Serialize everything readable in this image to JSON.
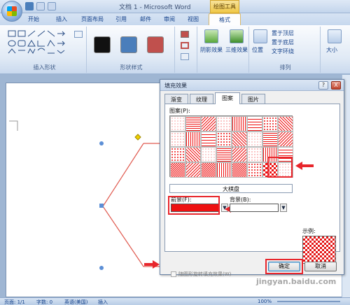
{
  "window": {
    "title": "文档 1 - Microsoft Word",
    "context_tools": "绘图工具"
  },
  "tabs": [
    "开始",
    "插入",
    "页面布局",
    "引用",
    "邮件",
    "审阅",
    "视图",
    "格式"
  ],
  "ribbon": {
    "groups": {
      "insert_shapes": "插入形状",
      "shape_styles": "形状样式",
      "arrange": "排列"
    },
    "buttons": {
      "shadow": "阴影效果",
      "three_d": "三维效果",
      "position": "位置",
      "bring_front": "置于顶层",
      "send_back": "置于底层",
      "text_wrap": "文字环绕",
      "size": "大小"
    },
    "style_colors": [
      "#111111",
      "#4a7ebb",
      "#c0504d"
    ]
  },
  "dialog": {
    "title": "填充效果",
    "tabs": [
      "渐变",
      "纹理",
      "图案",
      "图片"
    ],
    "active_tab": "图案",
    "pattern_label": "图案(P):",
    "selected_pattern": "大棋盘",
    "foreground_label": "前景(F):",
    "background_label": "背景(B):",
    "foreground_color": "#ee1111",
    "background_color": "#ffffff",
    "example_label": "示例:",
    "rotate_checkbox": "随图形旋转填充效果(W)",
    "ok": "确定",
    "cancel": "取消",
    "title_help": "?",
    "title_close": "X"
  },
  "status": {
    "page": "页面: 1/1",
    "words": "字数: 0",
    "language": "英语(美国)",
    "mode": "插入",
    "zoom": "100%"
  },
  "watermark": "jingyan.baidu.com"
}
